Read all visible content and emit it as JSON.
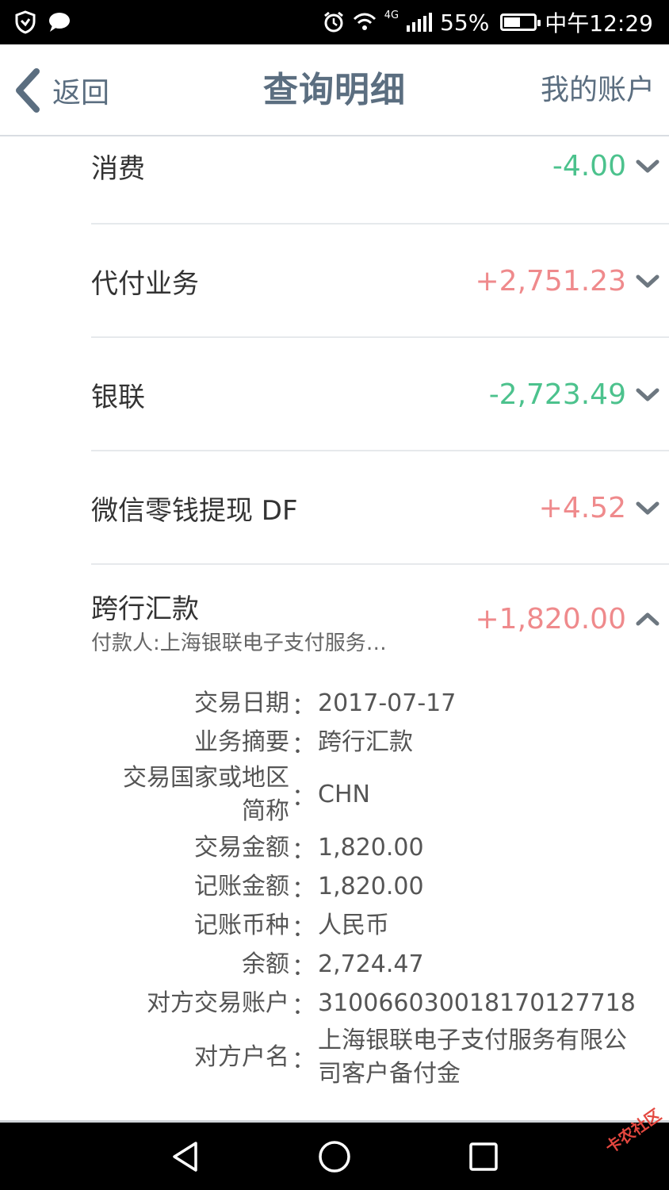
{
  "status_bar": {
    "network": "4G",
    "battery_percent": "55%",
    "battery_level": 0.55,
    "time": "中午12:29"
  },
  "header": {
    "back_label": "返回",
    "title": "查询明细",
    "right_label": "我的账户"
  },
  "transactions": [
    {
      "name": "消费",
      "amount": "-4.00",
      "type": "debit"
    },
    {
      "name": "代付业务",
      "amount": "+2,751.23",
      "type": "credit"
    },
    {
      "name": "银联",
      "amount": "-2,723.49",
      "type": "debit"
    },
    {
      "name": "微信零钱提现 DF",
      "amount": "+4.52",
      "type": "credit"
    }
  ],
  "expanded": {
    "name": "跨行汇款",
    "subtitle": "付款人:上海银联电子支付服务…",
    "amount": "+1,820.00",
    "details": [
      {
        "label": "交易日期",
        "value": "2017-07-17"
      },
      {
        "label": "业务摘要",
        "value": "跨行汇款"
      },
      {
        "label": "交易国家或地区简称",
        "value": "CHN"
      },
      {
        "label": "交易金额",
        "value": "1,820.00"
      },
      {
        "label": "记账金额",
        "value": "1,820.00"
      },
      {
        "label": "记账币种",
        "value": "人民币"
      },
      {
        "label": "余额",
        "value": "2,724.47"
      },
      {
        "label": "对方交易账户",
        "value": "310066030018170127718"
      },
      {
        "label": "对方户名",
        "value": "上海银联电子支付服务有限公司客户备付金"
      }
    ],
    "colon": "："
  },
  "colors": {
    "credit": "#ef8a8c",
    "debit": "#4cc28d",
    "header_text": "#5b6e80"
  },
  "watermark": "卡农社区"
}
